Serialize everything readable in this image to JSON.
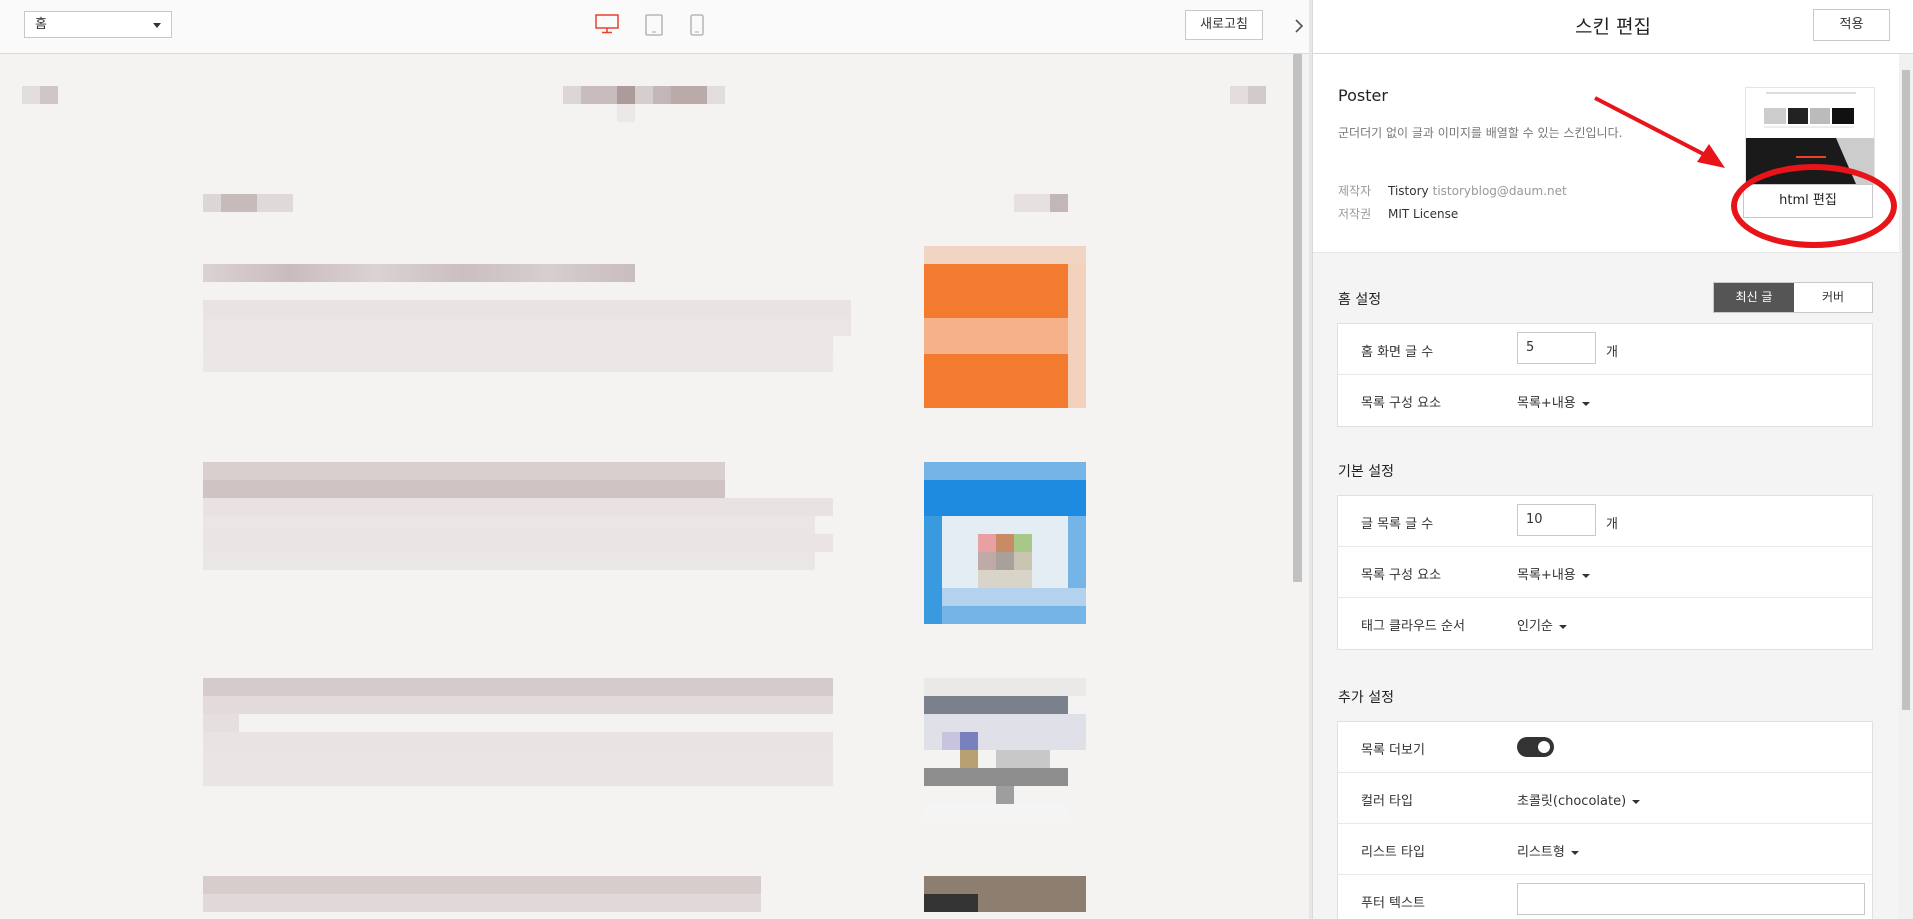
{
  "toolbar": {
    "page_select_value": "홈",
    "device_icons": [
      "desktop-icon",
      "tablet-icon",
      "mobile-icon"
    ],
    "refresh_label": "새로고침",
    "accent_color": "#e8412c"
  },
  "panel": {
    "title": "스킨 편집",
    "apply_label": "적용",
    "skin": {
      "name": "Poster",
      "description": "군더더기 없이 글과 이미지를 배열할 수 있는 스킨입니다.",
      "author_label": "제작자",
      "author_name": "Tistory",
      "author_email": "tistoryblog@daum.net",
      "license_label": "저작권",
      "license_value": "MIT License",
      "html_edit_label": "html 편집"
    },
    "home_settings": {
      "title": "홈 설정",
      "segment_options": [
        "최신 글",
        "커버"
      ],
      "selected_segment": "최신 글",
      "rows": [
        {
          "label": "홈 화면 글 수",
          "value": "5",
          "unit": "개"
        },
        {
          "label": "목록 구성 요소",
          "value": "목록+내용"
        }
      ]
    },
    "basic_settings": {
      "title": "기본 설정",
      "rows": [
        {
          "label": "글 목록 글 수",
          "value": "10",
          "unit": "개"
        },
        {
          "label": "목록 구성 요소",
          "value": "목록+내용"
        },
        {
          "label": "태그 클라우드 순서",
          "value": "인기순"
        }
      ]
    },
    "extra_settings": {
      "title": "추가 설정",
      "rows": [
        {
          "label": "목록 더보기",
          "toggle": true
        },
        {
          "label": "컬러 타입",
          "value": "초콜릿(chocolate)"
        },
        {
          "label": "리스트 타입",
          "value": "리스트형"
        },
        {
          "label": "푸터 텍스트",
          "value": ""
        }
      ]
    }
  },
  "annotation_color": "#e8141a"
}
